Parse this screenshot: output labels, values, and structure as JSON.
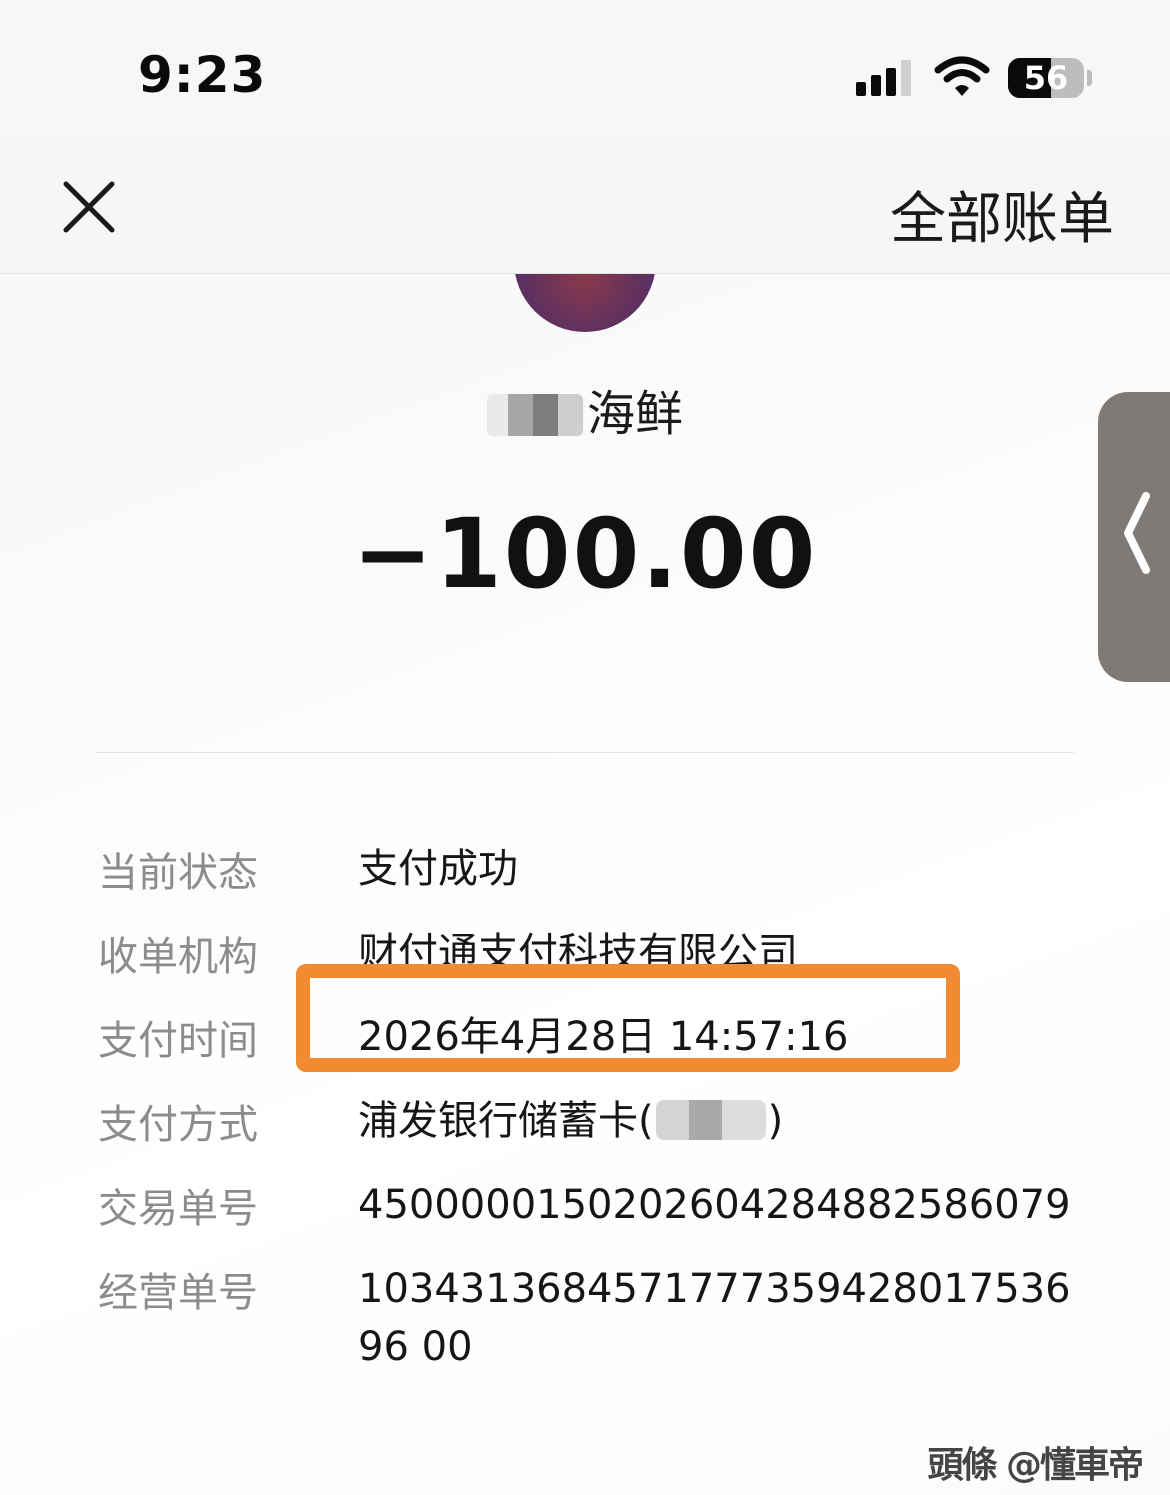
{
  "status_bar": {
    "time": "9:23",
    "battery_level": "56",
    "battery_fraction": 0.56
  },
  "nav": {
    "close_icon": "close-icon",
    "all_bills": "全部账单"
  },
  "merchant": {
    "name_visible": "海鲜",
    "avatar": "merchant-avatar"
  },
  "amount": "−100.00",
  "details": [
    {
      "label": "当前状态",
      "value": "支付成功"
    },
    {
      "label": "收单机构",
      "value": "财付通支付科技有限公司"
    },
    {
      "label": "支付时间",
      "value": "2026年4月28日 14:57:16"
    },
    {
      "label": "支付方式",
      "value_prefix": "浦发银行储蓄卡(",
      "value_suffix": ")"
    },
    {
      "label": "交易单号",
      "value": "4500000150202604284882586079"
    },
    {
      "label": "经营单号",
      "value": "103431368457177735942801753696 00"
    }
  ],
  "watermark": "頭條 @懂車帝",
  "colors": {
    "highlight": "#f28a32",
    "side_tab": "#7f7a76",
    "label_gray": "#8c8c8c"
  }
}
